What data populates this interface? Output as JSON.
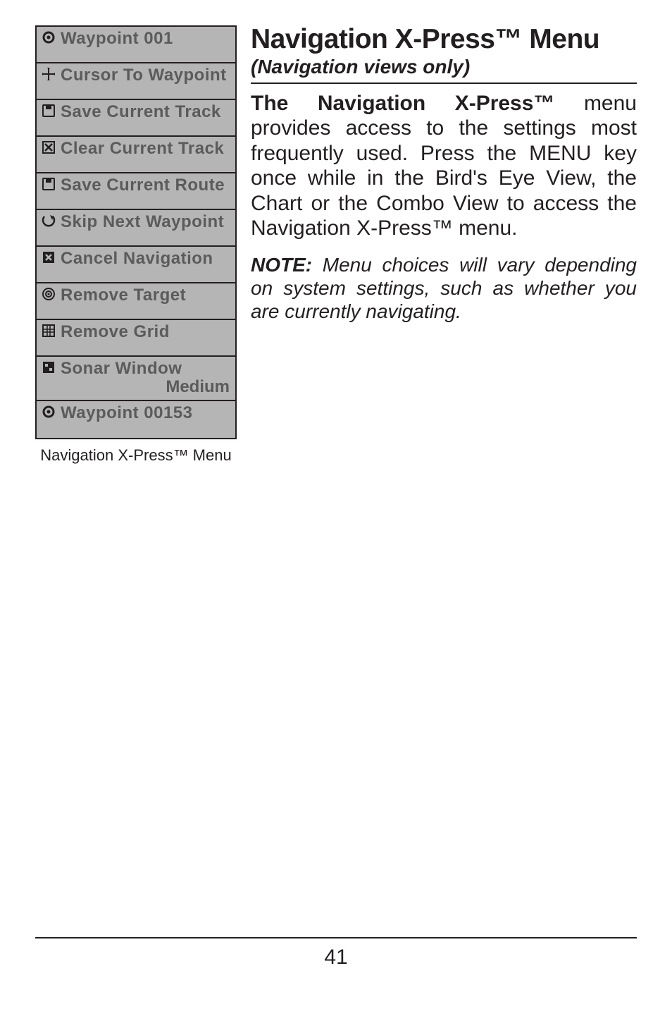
{
  "menu": {
    "items": [
      {
        "icon_name": "waypoint-icon",
        "label": "Waypoint 001"
      },
      {
        "icon_name": "cursor-to-waypoint-icon",
        "label": "Cursor To Waypoint"
      },
      {
        "icon_name": "save-track-icon",
        "label": "Save Current Track"
      },
      {
        "icon_name": "clear-track-icon",
        "label": "Clear Current Track"
      },
      {
        "icon_name": "save-route-icon",
        "label": "Save Current Route"
      },
      {
        "icon_name": "skip-waypoint-icon",
        "label": "Skip Next Waypoint"
      },
      {
        "icon_name": "cancel-nav-icon",
        "label": "Cancel Navigation"
      },
      {
        "icon_name": "remove-target-icon",
        "label": "Remove Target"
      },
      {
        "icon_name": "remove-grid-icon",
        "label": "Remove Grid"
      },
      {
        "icon_name": "sonar-window-icon",
        "label": "Sonar Window",
        "sub": "Medium"
      },
      {
        "icon_name": "waypoint-icon",
        "label": "Waypoint 00153"
      }
    ],
    "caption": "Navigation X-Press™ Menu"
  },
  "content": {
    "heading_text": "Navigation X-Press™ Menu",
    "subheading": "(Navigation views only)",
    "para_bold": "The Navigation X-Press™",
    "para_rest": " menu provides access to the settings most frequently used. Press the MENU key once while in the Bird's Eye View, the Chart or the Combo View to access the Navigation X-Press™ menu.",
    "note_label": "NOTE:",
    "note_text": "  Menu choices will vary depending on system settings, such as whether you are currently navigating."
  },
  "page_number": "41"
}
